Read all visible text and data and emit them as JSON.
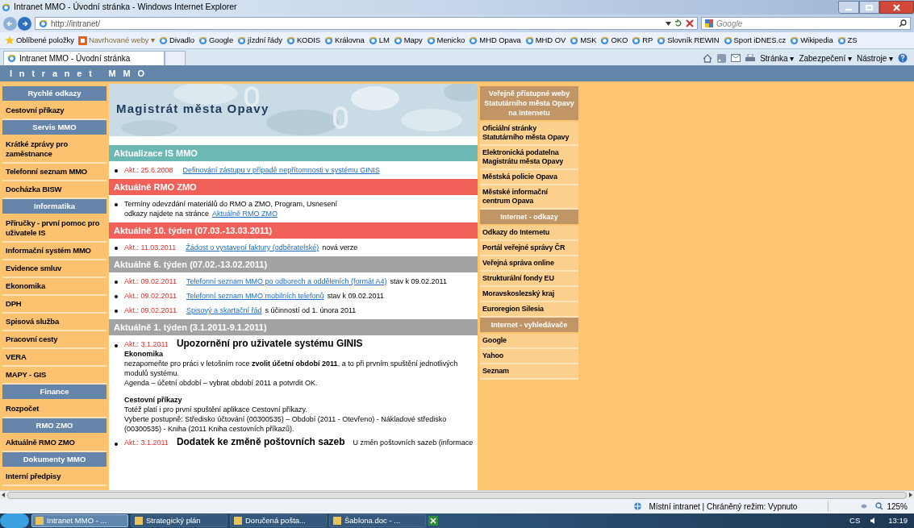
{
  "window": {
    "title": "Intranet MMO - Úvodní stránka - Windows Internet Explorer"
  },
  "address_bar": {
    "url": "http://intranet/",
    "search_placeholder": "Google"
  },
  "favorites": [
    {
      "label": "Oblíbené položky",
      "kind": "star"
    },
    {
      "label": "Navrhované weby ▾",
      "kind": "suggested"
    },
    {
      "label": "Divadlo",
      "kind": "page"
    },
    {
      "label": "Google",
      "kind": "page"
    },
    {
      "label": "jízdní řády",
      "kind": "page"
    },
    {
      "label": "KODIS",
      "kind": "page"
    },
    {
      "label": "Královna",
      "kind": "page"
    },
    {
      "label": "LM",
      "kind": "page"
    },
    {
      "label": "Mapy",
      "kind": "page"
    },
    {
      "label": "Menicko",
      "kind": "page"
    },
    {
      "label": "MHD Opava",
      "kind": "page"
    },
    {
      "label": "MHD OV",
      "kind": "page"
    },
    {
      "label": "MSK",
      "kind": "page"
    },
    {
      "label": "OKO",
      "kind": "page"
    },
    {
      "label": "RP",
      "kind": "page"
    },
    {
      "label": "Slovník REWIN",
      "kind": "page"
    },
    {
      "label": "Sport iDNES.cz",
      "kind": "page"
    },
    {
      "label": "Wikipedia",
      "kind": "page"
    },
    {
      "label": "ZS",
      "kind": "page"
    }
  ],
  "tab": {
    "label": "Intranet MMO - Úvodní stránka",
    "selected": true
  },
  "command_bar": [
    "Stránka ▾",
    "Zabezpečení ▾",
    "Nástroje ▾"
  ],
  "site_header": "Intranet MMO",
  "sidebar": [
    {
      "kind": "heading",
      "label": "Rychlé odkazy"
    },
    {
      "kind": "link",
      "label": "Cestovní příkazy"
    },
    {
      "kind": "heading",
      "label": "Servis MMO"
    },
    {
      "kind": "link",
      "label": "Krátké zprávy pro zaměstnance"
    },
    {
      "kind": "link",
      "label": "Telefonní seznam MMO"
    },
    {
      "kind": "link",
      "label": "Docházka BISW"
    },
    {
      "kind": "heading",
      "label": "Informatika"
    },
    {
      "kind": "link",
      "label": "Příručky - první pomoc pro uživatele IS"
    },
    {
      "kind": "link",
      "label": "Informační systém MMO"
    },
    {
      "kind": "link",
      "label": "Evidence smluv"
    },
    {
      "kind": "link",
      "label": "Ekonomika"
    },
    {
      "kind": "link",
      "label": "DPH"
    },
    {
      "kind": "link",
      "label": "Spisová služba"
    },
    {
      "kind": "link",
      "label": "Pracovní cesty"
    },
    {
      "kind": "link",
      "label": "VERA"
    },
    {
      "kind": "link",
      "label": "MAPY - GIS"
    },
    {
      "kind": "heading",
      "label": "Finance"
    },
    {
      "kind": "link",
      "label": "Rozpočet"
    },
    {
      "kind": "heading",
      "label": "RMO ZMO"
    },
    {
      "kind": "link",
      "label": "Aktuálně RMO ZMO"
    },
    {
      "kind": "heading",
      "label": "Dokumenty MMO"
    },
    {
      "kind": "link",
      "label": "Interní předpisy"
    }
  ],
  "banner": {
    "title": "Magistrát města Opavy"
  },
  "sections": [
    {
      "title": "Aktualizace IS MMO",
      "color": "#6cb8b4",
      "items": [
        {
          "kind": "dated",
          "date": "Akt.: 25.6.2008",
          "link": "Definování zástupu v případě nepřítomnosti v systému GINIS"
        }
      ]
    },
    {
      "title": "Aktuálně RMO ZMO",
      "color": "#f2605a",
      "items": [
        {
          "kind": "plain",
          "text": "Termíny odevzdání materiálů do RMO a ZMO, Program, Usnesení",
          "prefix": "odkazy najdete na stránce",
          "link": "Aktuálně RMO ZMO"
        }
      ]
    },
    {
      "title": "Aktuálně 10. týden (07.03.-13.03.2011)",
      "color": "#f2605a",
      "items": [
        {
          "kind": "dated",
          "date": "Akt.: 11.03.2011",
          "link": "Žádost o vystavení faktury (odběratelské)",
          "note": "nová verze"
        }
      ]
    },
    {
      "title": "Aktuálně 6. týden (07.02.-13.02.2011)",
      "color": "#a3a3a3",
      "items": [
        {
          "kind": "dated",
          "date": "Akt.: 09.02.2011",
          "link": "Telefonní seznam MMO po odborech a odděleních (formát A4)",
          "note": "stav k 09.02.2011"
        },
        {
          "kind": "dated",
          "date": "Akt.: 09.02.2011",
          "link": "Telefonní seznam MMO mobilních telefonů",
          "note": "stav k 09.02.2011"
        },
        {
          "kind": "dated",
          "date": "Akt.: 09.02.2011",
          "link": "Spisový a skartační řád",
          "note": "s účinností od 1. února 2011"
        }
      ]
    },
    {
      "title": "Aktuálně 1. týden (3.1.2011-9.1.2011)",
      "color": "#a3a3a3",
      "items": [
        {
          "kind": "notice",
          "date": "Akt.: 3.1.2011",
          "heading": "Upozornění pro uživatele systému GINIS",
          "blocks": [
            {
              "kind": "subheading",
              "text": "Ekonomika"
            },
            {
              "kind": "text",
              "text": "nezapomeňte pro práci v letošním roce **zvolit účetní období 2011**, a to při prvním spuštění jednotlivých modulů systému."
            },
            {
              "kind": "text",
              "text": "Agenda – účetní období – vybrat období 2011 a potvrdit OK."
            },
            {
              "kind": "subheading",
              "text": "Cestovní příkazy"
            },
            {
              "kind": "text",
              "text": "Totéž platí i pro první spuštění aplikace Cestovní příkazy."
            },
            {
              "kind": "text",
              "text": "Vyberte postupně: Středisko účtování (00300535) – Období (2011 - Otevřeno) - Nákladové středisko (00300535) - Kniha (2011 Kniha cestovních příkazů)."
            }
          ]
        },
        {
          "kind": "notice",
          "date": "Akt.: 3.1.2011",
          "heading": "Dodatek ke změně poštovních sazeb",
          "note": "U změn poštovních sazeb (informace"
        }
      ]
    }
  ],
  "right_column": [
    {
      "kind": "heading",
      "label": "Veřejně přístupné weby Statutárního města Opavy na Internetu"
    },
    {
      "kind": "link",
      "label": "Oficiální stránky Statutárního města Opavy"
    },
    {
      "kind": "link",
      "label": "Elektronická podatelna Magistrátu města Opavy"
    },
    {
      "kind": "link",
      "label": "Městská policie Opava"
    },
    {
      "kind": "link",
      "label": "Městské informační centrum Opava"
    },
    {
      "kind": "heading",
      "label": "Internet - odkazy"
    },
    {
      "kind": "link",
      "label": "Odkazy do Internetu"
    },
    {
      "kind": "link",
      "label": "Portál veřejné správy ČR"
    },
    {
      "kind": "link",
      "label": "Veřejná správa online"
    },
    {
      "kind": "link",
      "label": "Strukturální fondy EU"
    },
    {
      "kind": "link",
      "label": "Moravskoslezský kraj"
    },
    {
      "kind": "link",
      "label": "Euroregion Silesia"
    },
    {
      "kind": "heading",
      "label": "Internet - vyhledávače"
    },
    {
      "kind": "link",
      "label": "Google"
    },
    {
      "kind": "link",
      "label": "Yahoo"
    },
    {
      "kind": "link",
      "label": "Seznam"
    }
  ],
  "status_bar": {
    "zone": "Místní intranet | Chráněný režim: Vypnuto",
    "zoom": "125%"
  },
  "taskbar": {
    "items": [
      {
        "label": "Intranet MMO - ...",
        "selected": true
      },
      {
        "label": "Strategický plán",
        "selected": false
      },
      {
        "label": "Doručená pošta...",
        "selected": false
      },
      {
        "label": "Šablona.doc - ...",
        "selected": false
      }
    ],
    "language": "CS",
    "time": "13:19"
  }
}
